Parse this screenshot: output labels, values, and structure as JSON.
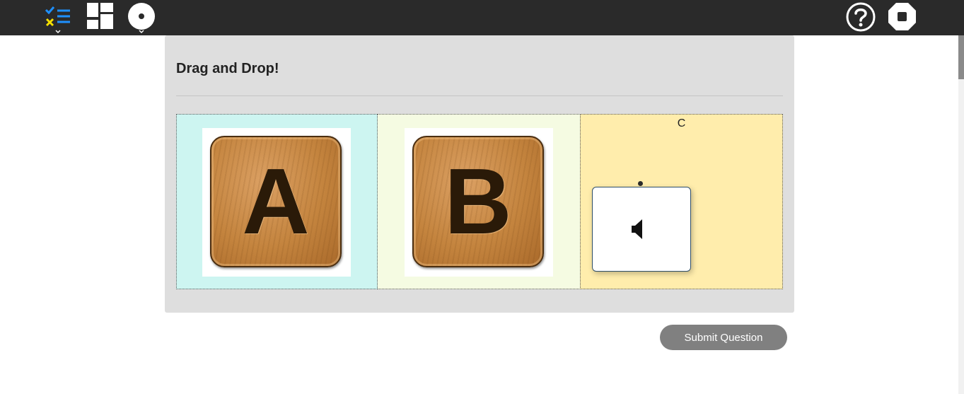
{
  "toolbar": {
    "left_icons": [
      "checklist-icon",
      "layout-grid-icon",
      "record-disc-icon"
    ],
    "right_icons": [
      "help-icon",
      "stop-icon"
    ]
  },
  "question": {
    "title": "Drag and Drop!",
    "zones": [
      {
        "label": "",
        "tile_letter": "A",
        "background": "#cdf5f1"
      },
      {
        "label": "",
        "tile_letter": "B",
        "background": "#f5fbe2"
      },
      {
        "label": "C",
        "background": "#ffedac"
      }
    ],
    "draggable": {
      "icon": "speaker-icon"
    }
  },
  "submit": {
    "label": "Submit Question"
  },
  "colors": {
    "topbar": "#2a2a2a",
    "panel": "#dedede",
    "checklist_check": "#1e90ff",
    "checklist_cross": "#f5e000",
    "submit_button": "#808080"
  }
}
